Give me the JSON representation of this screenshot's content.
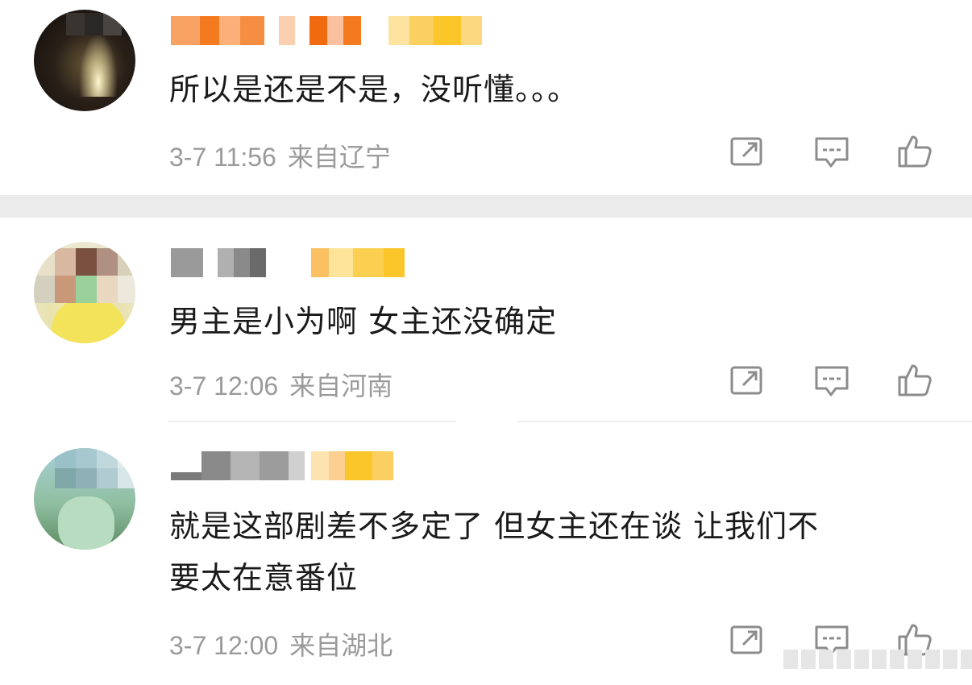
{
  "comments": [
    {
      "text": "所以是还是不是，没听懂。。。",
      "time": "3-7 11:56",
      "location": "来自辽宁",
      "repost_icon": "repost-icon",
      "reply_icon": "comment-icon",
      "like_icon": "thumbs-up-icon"
    },
    {
      "text": "男主是小为啊 女主还没确定",
      "time": "3-7 12:06",
      "location": "来自河南",
      "repost_icon": "repost-icon",
      "reply_icon": "comment-icon",
      "like_icon": "thumbs-up-icon"
    },
    {
      "text_line1": "就是这部剧差不多定了 但女主还在谈 让我们不",
      "text_line2": "要太在意番位",
      "time": "3-7 12:00",
      "location": "来自湖北",
      "repost_icon": "repost-icon",
      "reply_icon": "comment-icon",
      "like_icon": "thumbs-up-icon"
    }
  ],
  "colors": {
    "nickname_orange": "#f47a20",
    "badge_gold": "#fbc62a",
    "meta_gray": "#9a9a9a",
    "text_dark": "#1a1a1a",
    "icon_gray": "#8c8c8c"
  }
}
